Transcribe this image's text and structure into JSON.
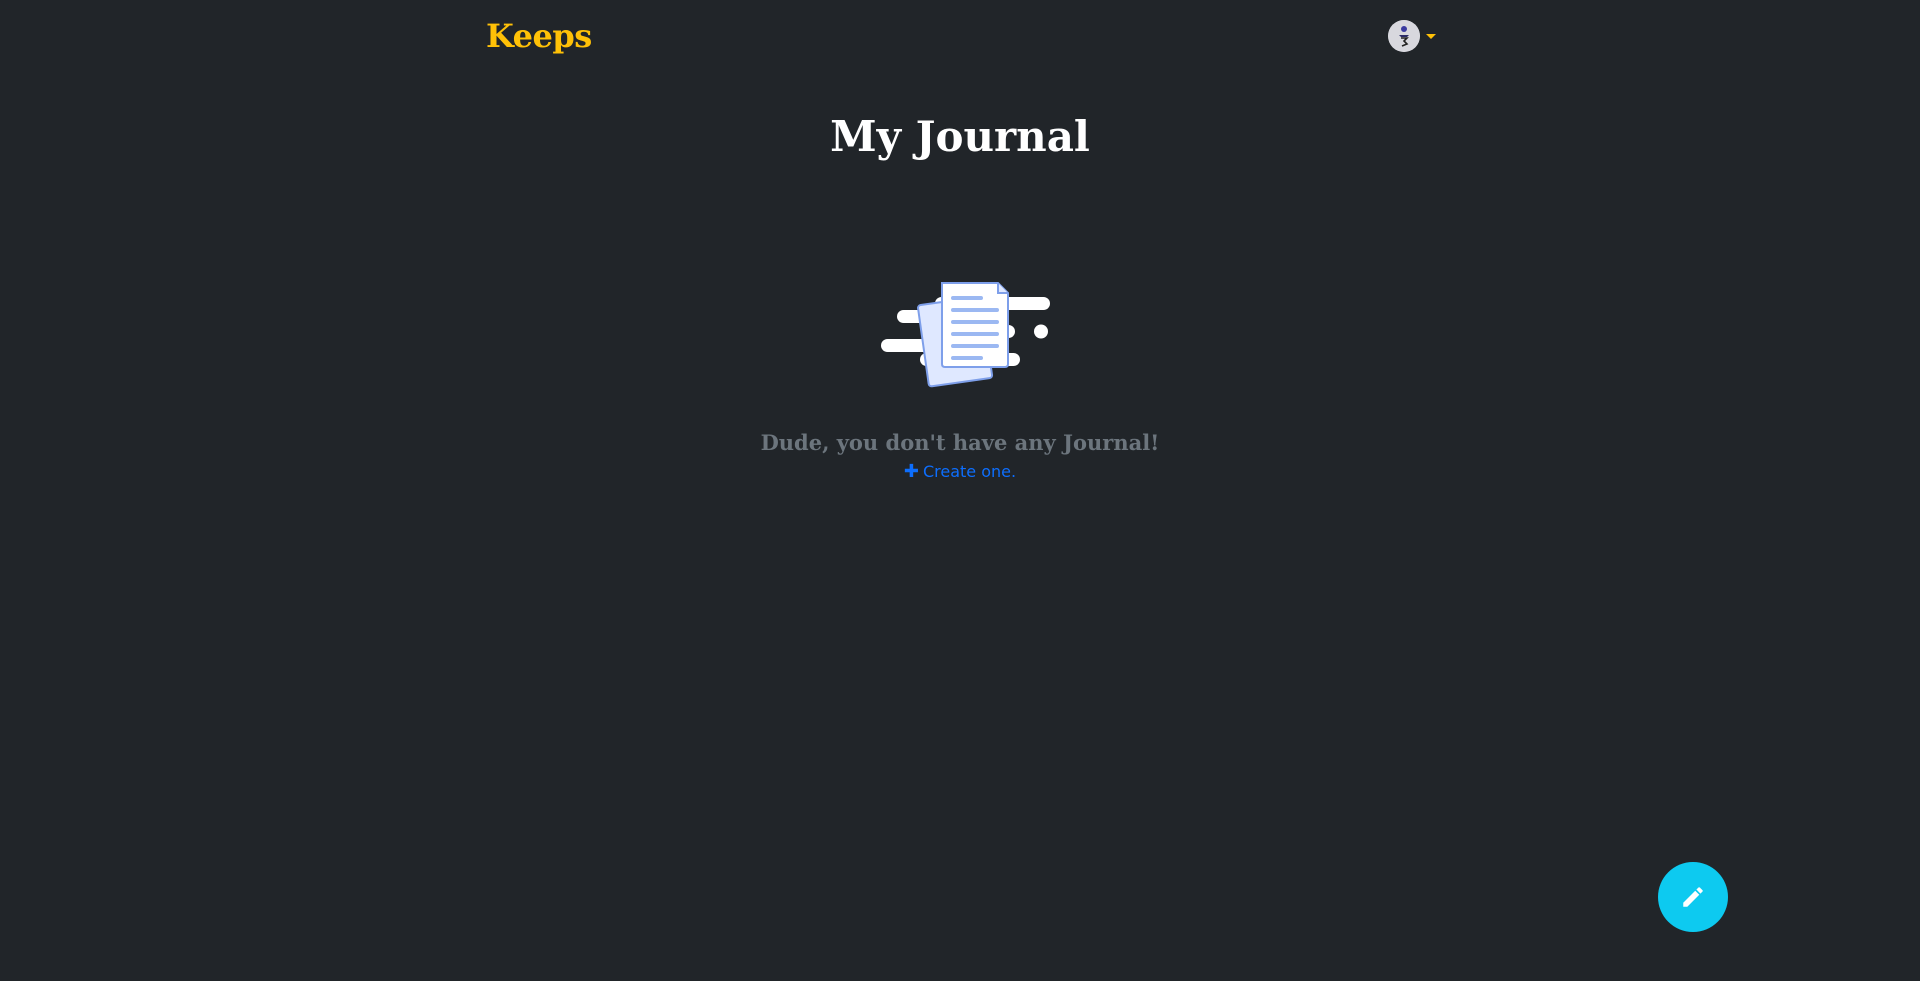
{
  "navbar": {
    "brand": "Keeps",
    "avatar_icon": "user-avatar",
    "caret_icon": "caret-down-icon"
  },
  "main": {
    "title": "My Journal",
    "illustration_icon": "empty-documents-illustration",
    "empty_message": "Dude, you don't have any Journal!",
    "create_link_label": "Create one.",
    "create_link_icon": "plus-icon"
  },
  "fab": {
    "icon": "pencil-icon"
  },
  "colors": {
    "background": "#212529",
    "brand": "#ffc107",
    "title": "#ffffff",
    "muted": "#6c757d",
    "link": "#0d6efd",
    "fab": "#0dcaf0"
  }
}
